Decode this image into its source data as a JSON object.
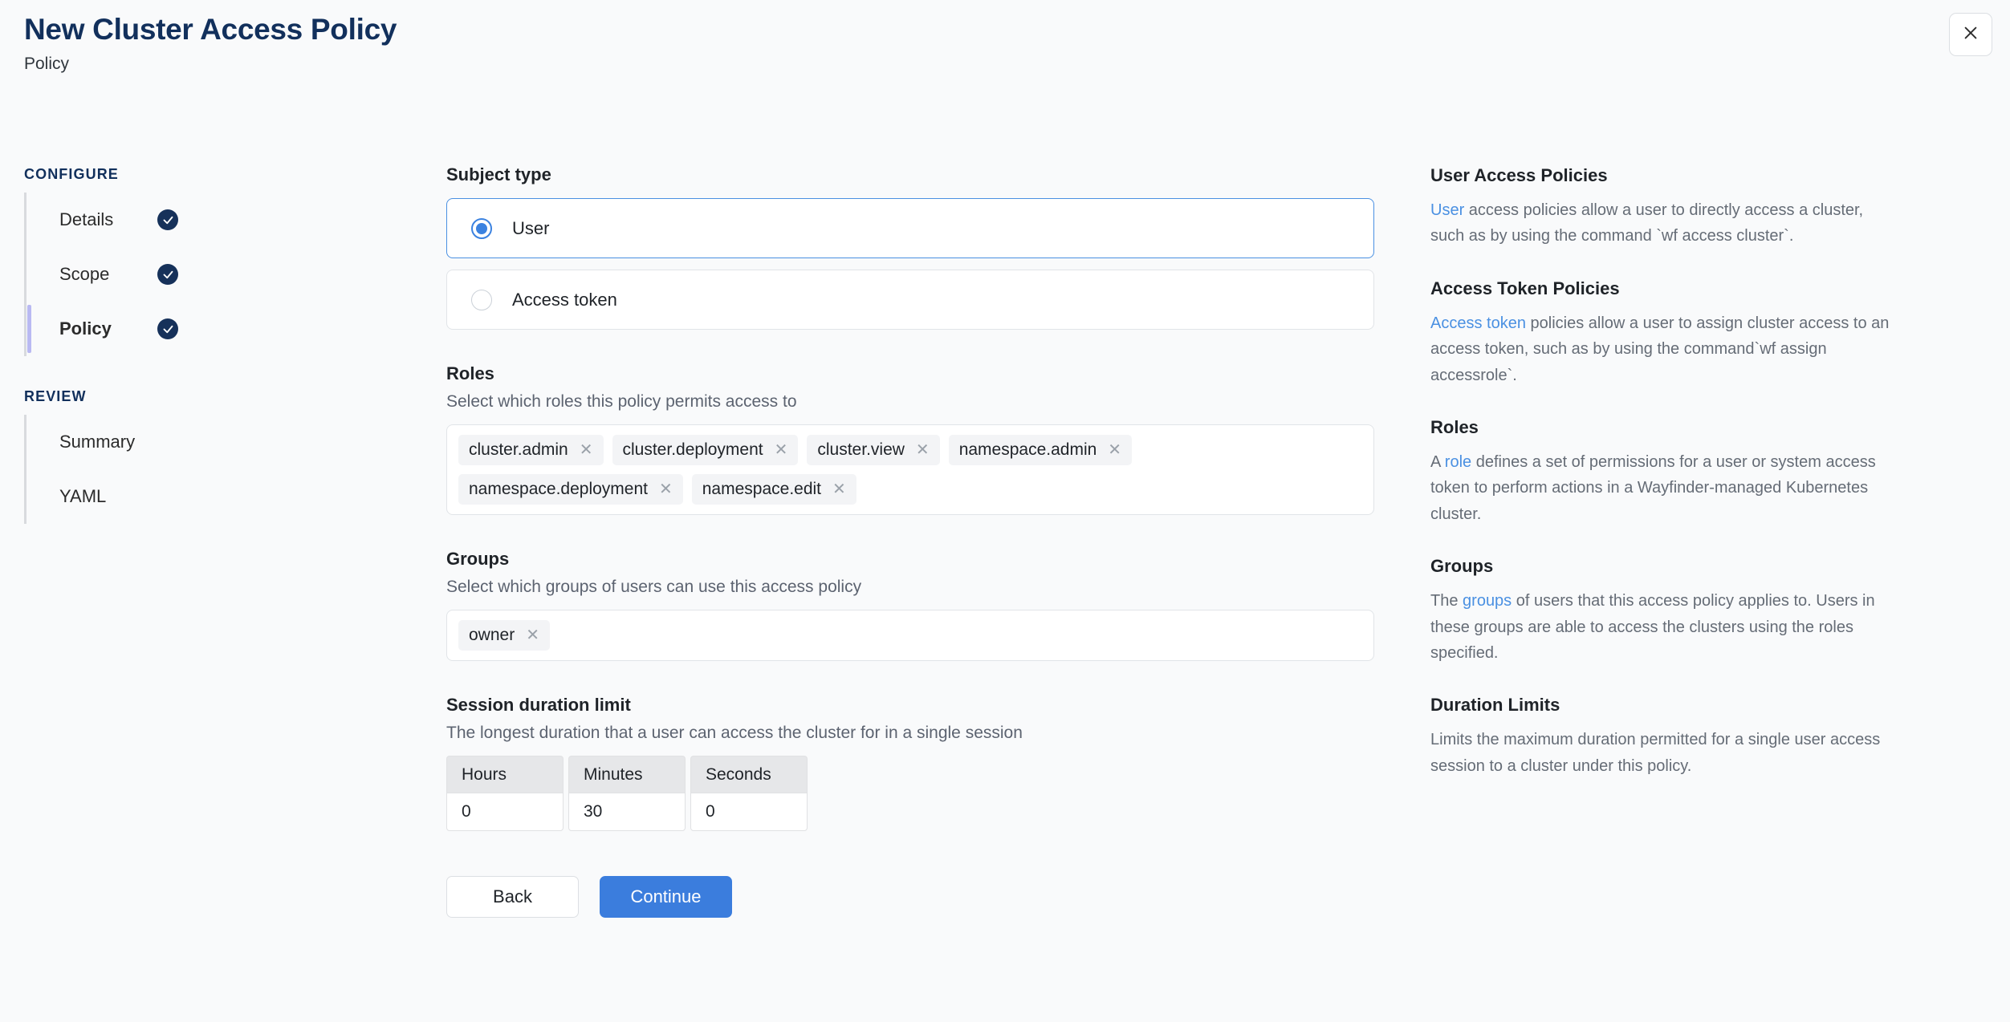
{
  "header": {
    "title": "New Cluster Access Policy",
    "subtitle": "Policy",
    "close_label": "close"
  },
  "sidebar": {
    "sections": [
      {
        "title": "CONFIGURE",
        "items": [
          {
            "label": "Details",
            "complete": true,
            "active": false
          },
          {
            "label": "Scope",
            "complete": true,
            "active": false
          },
          {
            "label": "Policy",
            "complete": true,
            "active": true
          }
        ]
      },
      {
        "title": "REVIEW",
        "items": [
          {
            "label": "Summary",
            "complete": false,
            "active": false
          },
          {
            "label": "YAML",
            "complete": false,
            "active": false
          }
        ]
      }
    ]
  },
  "form": {
    "subject_type": {
      "label": "Subject type",
      "options": [
        {
          "label": "User",
          "selected": true
        },
        {
          "label": "Access token",
          "selected": false
        }
      ]
    },
    "roles": {
      "label": "Roles",
      "help": "Select which roles this policy permits access to",
      "chips": [
        "cluster.admin",
        "cluster.deployment",
        "cluster.view",
        "namespace.admin",
        "namespace.deployment",
        "namespace.edit"
      ]
    },
    "groups": {
      "label": "Groups",
      "help": "Select which groups of users can use this access policy",
      "chips": [
        "owner"
      ]
    },
    "session_duration": {
      "label": "Session duration limit",
      "help": "The longest duration that a user can access the cluster for in a single session",
      "columns": [
        {
          "header": "Hours",
          "value": "0"
        },
        {
          "header": "Minutes",
          "value": "30"
        },
        {
          "header": "Seconds",
          "value": "0"
        }
      ]
    },
    "actions": {
      "back_label": "Back",
      "continue_label": "Continue"
    }
  },
  "help_panel": {
    "blocks": [
      {
        "title": "User Access Policies",
        "link": "User",
        "rest": " access policies allow a user to directly access a cluster, such as by using the command `wf access cluster`."
      },
      {
        "title": "Access Token Policies",
        "link": "Access token",
        "rest": " policies allow a user to assign cluster access to an access token, such as by using the command`wf assign accessrole`."
      },
      {
        "title": "Roles",
        "prefix": "A ",
        "link": "role",
        "rest": " defines a set of permissions for a user or system access token to perform actions in a Wayfinder-managed Kubernetes cluster."
      },
      {
        "title": "Groups",
        "prefix": "The ",
        "link": "groups",
        "rest": " of users that this access policy applies to. Users in these groups are able to access the clusters using the roles specified."
      },
      {
        "title": "Duration Limits",
        "rest": "Limits the maximum duration permitted for a single user access session to a cluster under this policy."
      }
    ]
  },
  "colors": {
    "title_navy": "#12305c",
    "accent_blue": "#3b7ddd",
    "radio_blue": "#3b82e0",
    "active_rail": "#b9b9f2",
    "check_badge": "#16315a",
    "link_blue": "#4a90e2"
  }
}
